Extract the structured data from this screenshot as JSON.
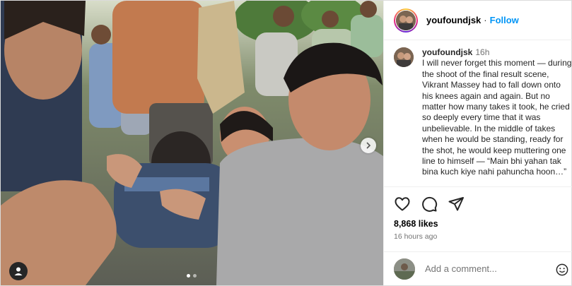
{
  "post": {
    "username": "youfoundjsk",
    "follow_label": "Follow",
    "separator": "·",
    "caption": {
      "username": "youfoundjsk",
      "time": "16h",
      "text": "I will never forget this moment — during the shoot of the final result scene, Vikrant Massey had to fall down onto his knees again and again. But no matter how many takes it took, he cried so deeply every time that it was unbelievable. In the middle of takes when he would be standing, ready for the shot, he would keep muttering one line to himself — “Main bhi yahan tak bina kuch kiye nahi pahuncha hoon…”"
    },
    "likes": "8,868 likes",
    "posted_ago": "16 hours ago",
    "comment_placeholder": "Add a comment...",
    "carousel": {
      "current": 1,
      "total": 2
    },
    "icons": [
      "heart-icon",
      "comment-icon",
      "share-icon",
      "chevron-right-icon",
      "user-tag-icon",
      "emoji-icon"
    ],
    "colors": {
      "accent": "#0095f6",
      "muted": "#737373",
      "text": "#262626"
    }
  }
}
